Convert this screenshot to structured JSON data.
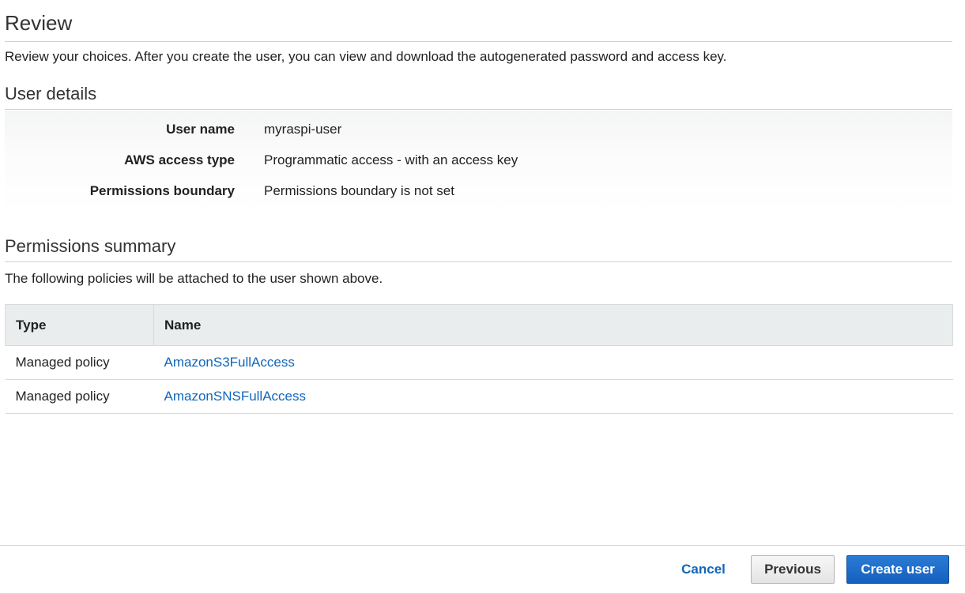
{
  "review": {
    "title": "Review",
    "description": "Review your choices. After you create the user, you can view and download the autogenerated password and access key."
  },
  "user_details": {
    "title": "User details",
    "rows": [
      {
        "label": "User name",
        "value": "myraspi-user"
      },
      {
        "label": "AWS access type",
        "value": "Programmatic access - with an access key"
      },
      {
        "label": "Permissions boundary",
        "value": "Permissions boundary is not set"
      }
    ]
  },
  "permissions": {
    "title": "Permissions summary",
    "description": "The following policies will be attached to the user shown above.",
    "columns": [
      "Type",
      "Name"
    ],
    "rows": [
      {
        "type": "Managed policy",
        "name": "AmazonS3FullAccess"
      },
      {
        "type": "Managed policy",
        "name": "AmazonSNSFullAccess"
      }
    ]
  },
  "footer": {
    "cancel_label": "Cancel",
    "previous_label": "Previous",
    "create_label": "Create user"
  },
  "colors": {
    "link": "#1166bb",
    "primary_button": "#1a68c5",
    "table_header_bg": "#eaeded"
  }
}
